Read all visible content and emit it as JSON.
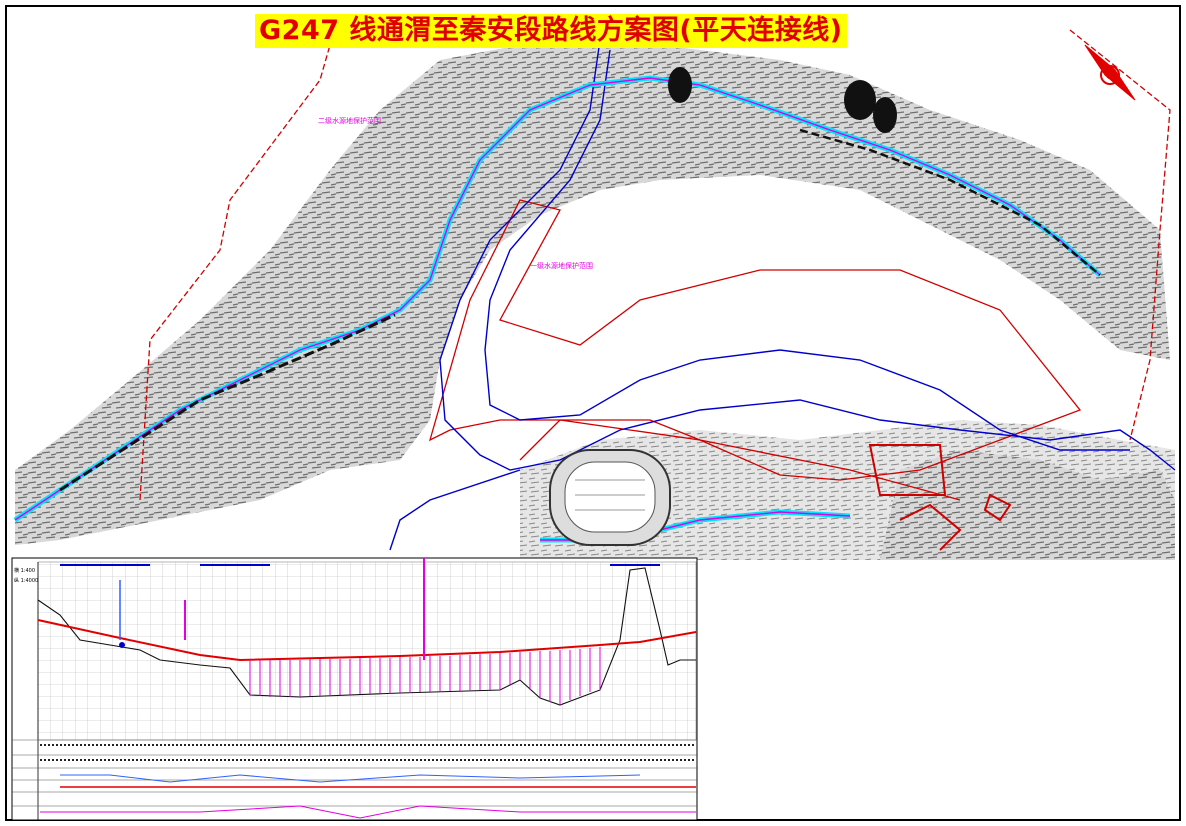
{
  "title": "G247 线通渭至秦安段路线方案图(平天连接线)",
  "labels": {
    "protection_zone_2": "二级水源地保护范围",
    "protection_zone_1": "一级水源地保护范围"
  },
  "profile": {
    "scale_h": "横 1:400",
    "scale_v": "纵 1:4000"
  },
  "colors": {
    "terrain": "#7a7a7a",
    "road": "#00e5ff",
    "alignment": "#e000e0",
    "boundary_red": "#d00000",
    "boundary_blue": "#0000cc",
    "title_bg": "#ffff00",
    "title_fg": "#e00000"
  },
  "icons": {
    "north_arrow": "north-arrow-icon"
  }
}
